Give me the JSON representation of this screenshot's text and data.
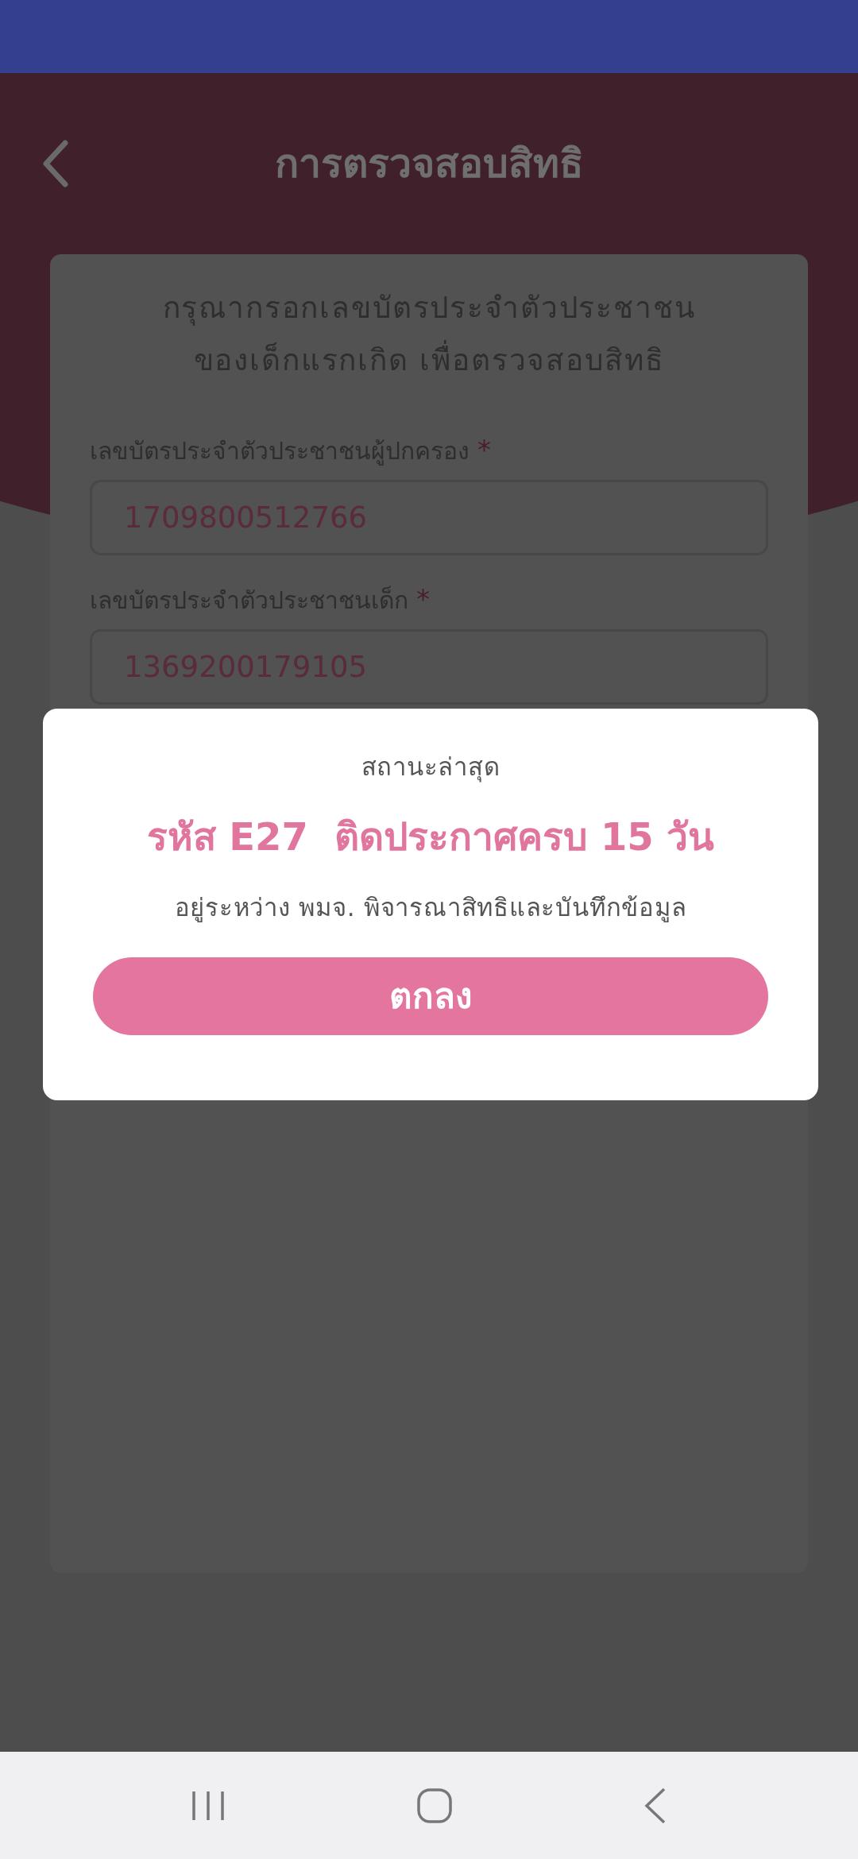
{
  "header": {
    "title": "การตรวจสอบสิทธิ"
  },
  "form": {
    "instructions": [
      "กรุณากรอกเลขบัตรประจำตัวประชาชน",
      "ของเด็กแรกเกิด เพื่อตรวจสอบสิทธิ"
    ],
    "fields": [
      {
        "label": "เลขบัตรประจำตัวประชาชนผู้ปกครอง",
        "required_mark": "*",
        "value": "1709800512766"
      },
      {
        "label": "เลขบัตรประจำตัวประชาชนเด็ก",
        "required_mark": "*",
        "value": "1369200179105"
      }
    ]
  },
  "dialog": {
    "title": "สถานะล่าสุด",
    "heading": "รหัส E27  ติดประกาศครบ 15 วัน",
    "message": "อยู่ระหว่าง พมจ. พิจารณาสิทธิและบันทึกข้อมูล",
    "button": "ตกลง"
  }
}
